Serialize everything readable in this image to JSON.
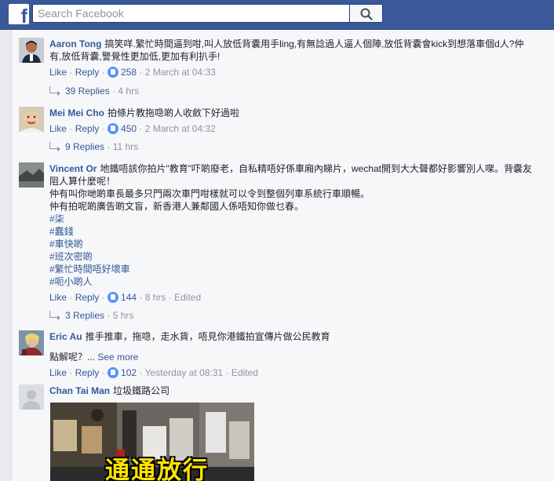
{
  "header": {
    "logo_letter": "f",
    "search_placeholder": "Search Facebook"
  },
  "colors": {
    "brand": "#3b5998",
    "link": "#365899",
    "muted": "#90949c",
    "like": "#5890ff"
  },
  "comments": [
    {
      "author": "Aaron Tong",
      "text_lines": [
        "搞笑咩.繁忙時間逼到咁,叫人放低背囊用手ling,有無諗過人逼人個陣,放低背囊會kick到想落車個d人?仲",
        "有,放低背囊,警覺性更加低,更加有利扒手!"
      ],
      "like": "Like",
      "reply": "Reply",
      "likes": "258",
      "time": "2 March at 04:33",
      "replies_label": "39 Replies",
      "replies_time": "4 hrs"
    },
    {
      "author": "Mei Mei Cho",
      "text_lines": [
        "拍條片教拖喼啲人收斂下好過啦"
      ],
      "like": "Like",
      "reply": "Reply",
      "likes": "450",
      "time": "2 March at 04:32",
      "replies_label": "9 Replies",
      "replies_time": "11 hrs"
    },
    {
      "author": "Vincent Or",
      "text_lines": [
        "地鐵唔該你拍片\"教育\"吓啲廢老，自私精唔好係車廂內睇片，wechat開到大大聲都好影響別人㗎。背囊友",
        "阻人算什麼呢！",
        "仲有叫你哋啲車長最多只門兩次車門咁樣就可以令到整個列車系統行車順暢。",
        "仲有拍呢啲廣告啲文盲，新香港人兼鄰國人係唔知你做乜春。"
      ],
      "hashtags": [
        "#柒",
        "#蠢錢",
        "#車快啲",
        "#班次密啲",
        "#繁忙時間唔好壞車",
        "#呃小啲人"
      ],
      "like": "Like",
      "reply": "Reply",
      "likes": "144",
      "time": "8 hrs",
      "edited": "Edited",
      "replies_label": "3 Replies",
      "replies_time": "5 hrs"
    },
    {
      "author": "Eric Au",
      "text_lines": [
        "推手推車，拖喼，走水貨，唔見你港鐵拍宣傳片做公民教育"
      ],
      "more_text": "點解呢？...",
      "see_more": "See more",
      "like": "Like",
      "reply": "Reply",
      "likes": "102",
      "time": "Yesterday at 08:31",
      "edited": "Edited"
    },
    {
      "author": "Chan Tai Man",
      "text_lines": [
        "垃圾鐵路公司"
      ],
      "image_caption": "通通放行"
    }
  ]
}
